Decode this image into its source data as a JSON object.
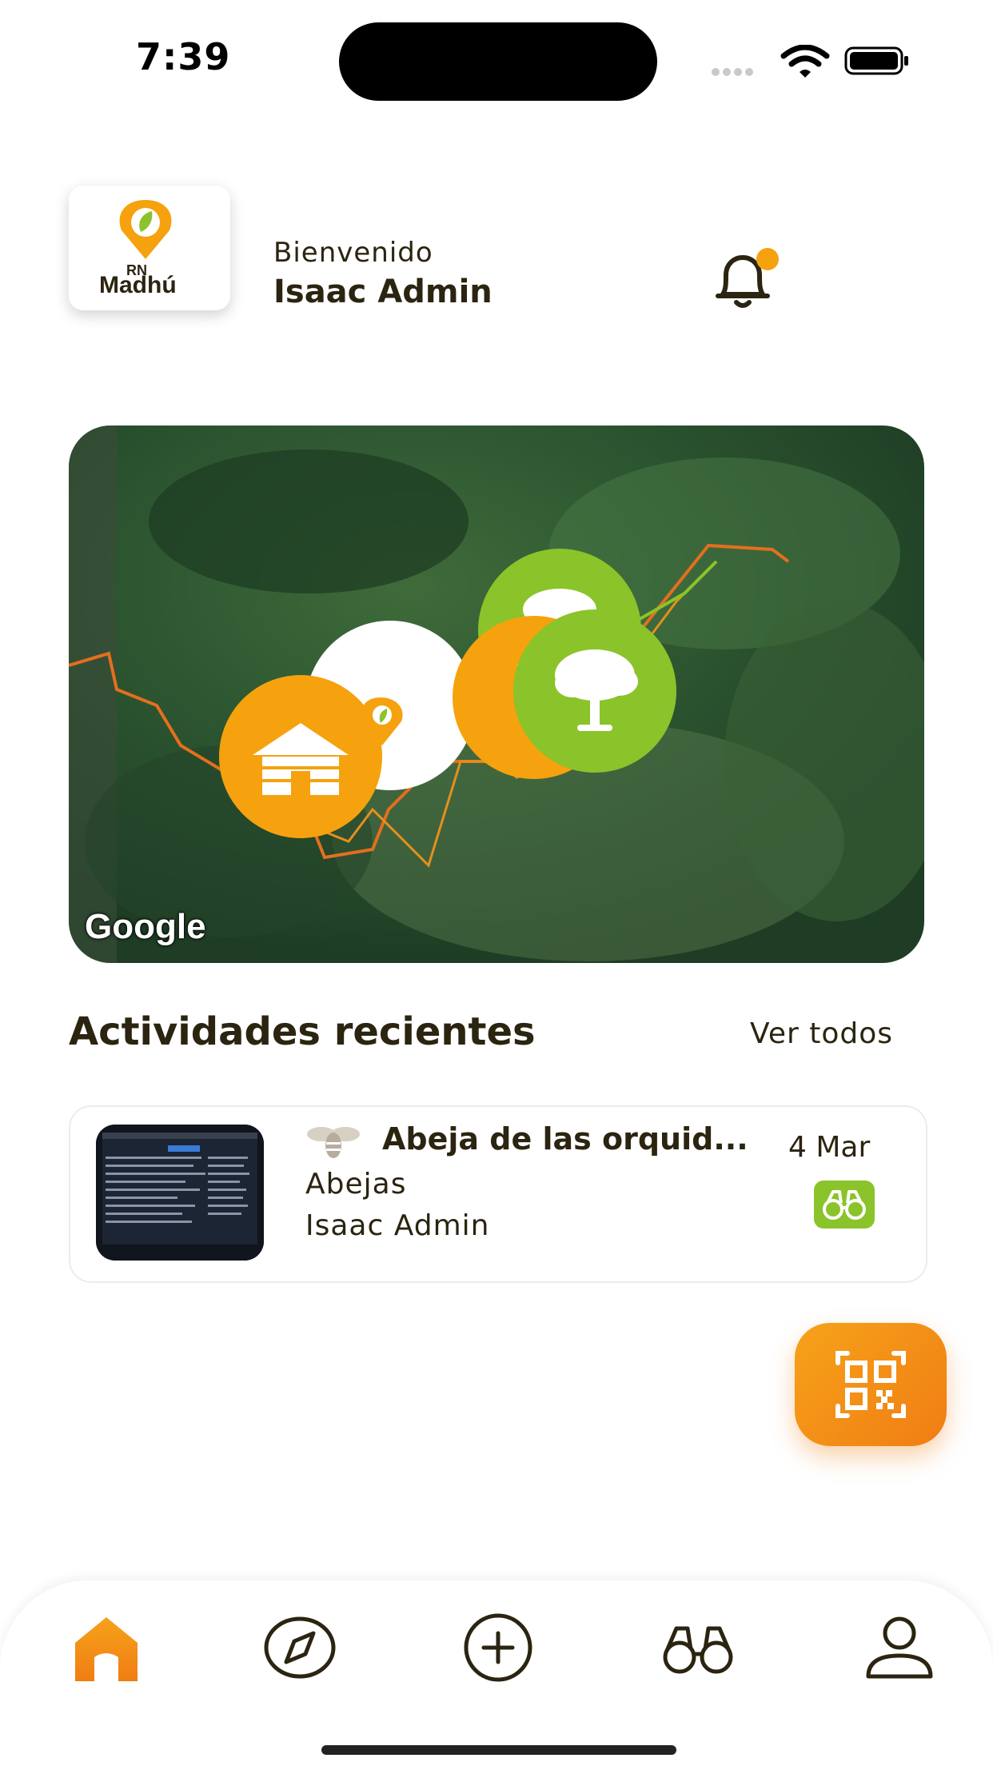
{
  "status_bar": {
    "time": "7:39"
  },
  "header": {
    "logo_text_top": "RN",
    "logo_text_bottom": "Madhú",
    "greeting": "Bienvenido",
    "user_name": "Isaac Admin"
  },
  "map": {
    "attribution": "Google"
  },
  "recent": {
    "title": "Actividades recientes",
    "see_all": "Ver todos",
    "items": [
      {
        "title": "Abeja de las orquid...",
        "date": "4 Mar",
        "category": "Abejas",
        "user": "Isaac Admin",
        "category_icon": "bee-icon",
        "type_icon": "binoculars-icon"
      }
    ]
  },
  "fab": {
    "icon": "qr-scan-icon"
  },
  "nav": {
    "items": [
      {
        "icon": "home-icon",
        "active": true
      },
      {
        "icon": "compass-icon",
        "active": false
      },
      {
        "icon": "plus-circle-icon",
        "active": false
      },
      {
        "icon": "binoculars-icon",
        "active": false
      },
      {
        "icon": "profile-icon",
        "active": false
      }
    ]
  },
  "colors": {
    "accent": "#f5a20e",
    "green": "#8bc32a",
    "text": "#2b2410"
  }
}
